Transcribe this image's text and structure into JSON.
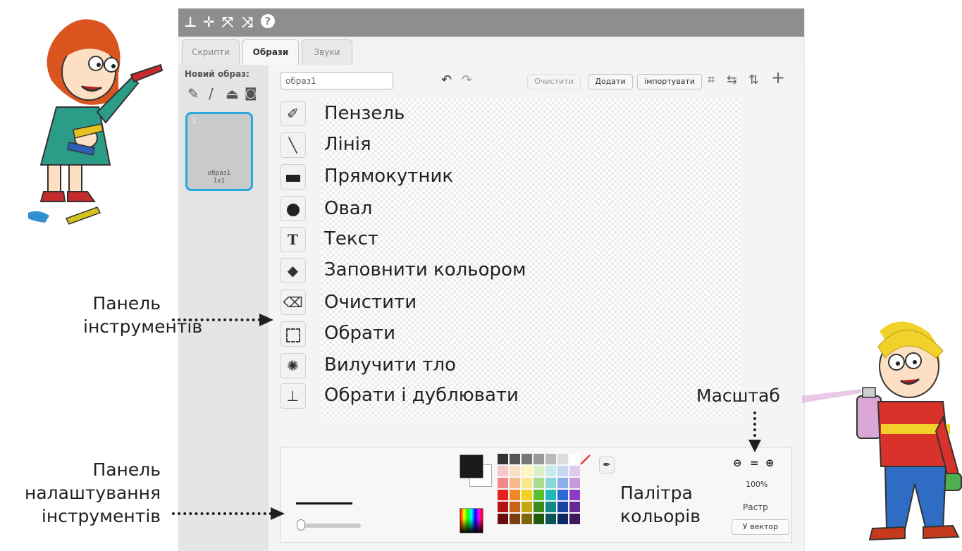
{
  "toolbar_icons": [
    "stamp-icon",
    "grow-icon",
    "expand-icon",
    "shrink-icon",
    "help-icon"
  ],
  "tabs": [
    {
      "label": "Скрипти"
    },
    {
      "label": "Образи"
    },
    {
      "label": "Звуки"
    }
  ],
  "left_panel": {
    "new_costume_label": "Новий образ:",
    "icons": [
      "paint-new-icon",
      "brush-line-icon",
      "upload-icon",
      "camera-icon"
    ],
    "costume": {
      "number": "1",
      "name": "образ1",
      "size": "1x1"
    }
  },
  "editor": {
    "costume_name": "образ1",
    "buttons": {
      "clear": "Очистити",
      "add": "Додати",
      "import": "імпортувати"
    }
  },
  "tools": [
    {
      "icon": "brush-icon",
      "label": "Пензель"
    },
    {
      "icon": "line-icon",
      "label": "Лінія"
    },
    {
      "icon": "rectangle-icon",
      "label": "Прямокутник"
    },
    {
      "icon": "ellipse-icon",
      "label": "Овал"
    },
    {
      "icon": "text-icon",
      "label": "Текст"
    },
    {
      "icon": "fill-icon",
      "label": "Заповнити кольором"
    },
    {
      "icon": "eraser-icon",
      "label": "Очистити"
    },
    {
      "icon": "select-icon",
      "label": "Обрати"
    },
    {
      "icon": "remove-background-icon",
      "label": "Вилучити тло"
    },
    {
      "icon": "stamp-icon",
      "label": "Обрати і дублювати"
    }
  ],
  "settings": {
    "zoom_level": "100%",
    "mode_label": "Растр",
    "convert_button": "У вектор",
    "palette_colors": [
      "#333333",
      "#555555",
      "#777777",
      "#999999",
      "#bbbbbb",
      "#dddddd",
      "#ffffff",
      "#f7c6c6",
      "#fbe0c0",
      "#fdf3bf",
      "#d8f0c4",
      "#c6ecec",
      "#c6d8f2",
      "#e0cbee",
      "#f08a8a",
      "#f6b98a",
      "#f9e58a",
      "#a9dc8e",
      "#8ad8d8",
      "#8aaee8",
      "#c59bdd",
      "#e52222",
      "#ef8a22",
      "#f2d21e",
      "#5cbd2e",
      "#1fb7b7",
      "#2a68d6",
      "#8e3cc8",
      "#b01414",
      "#c86414",
      "#c8a810",
      "#3c8c1c",
      "#128888",
      "#1a44a0",
      "#662a94",
      "#6a0c0c",
      "#7c3e0c",
      "#7c680a",
      "#245a10",
      "#0a5656",
      "#0e2a66",
      "#40185e"
    ]
  },
  "annotations": {
    "toolbar_panel": [
      "Панель",
      "інструментів"
    ],
    "settings_panel": [
      "Панель",
      "налаштування",
      "інструментів"
    ],
    "zoom": "Масштаб",
    "palette": [
      "Палітра",
      "кольорів"
    ]
  }
}
